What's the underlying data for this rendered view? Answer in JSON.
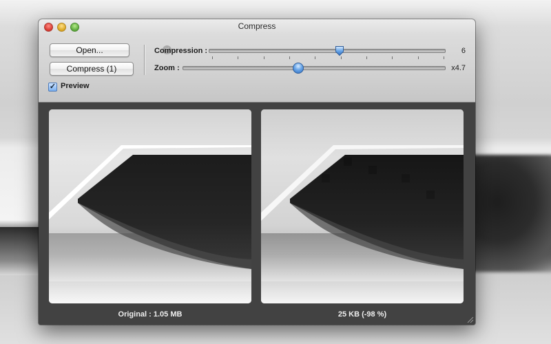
{
  "window": {
    "title": "Compress"
  },
  "toolbar": {
    "open_label": "Open...",
    "compress_label": "Compress (1)",
    "preview_label": "Preview",
    "preview_checked": true
  },
  "sliders": {
    "compression": {
      "label": "Compression :",
      "value": "6",
      "level": 0.6
    },
    "zoom": {
      "label": "Zoom :",
      "value": "x4.7",
      "level": 0.44
    }
  },
  "preview": {
    "original_caption": "Original : 1.05 MB",
    "compressed_caption": "25 KB (-98 %)"
  },
  "icons": {
    "clear": "circle-x-icon",
    "checkbox": "checkmark-icon"
  },
  "colors": {
    "accent": "#3a7bd5"
  }
}
